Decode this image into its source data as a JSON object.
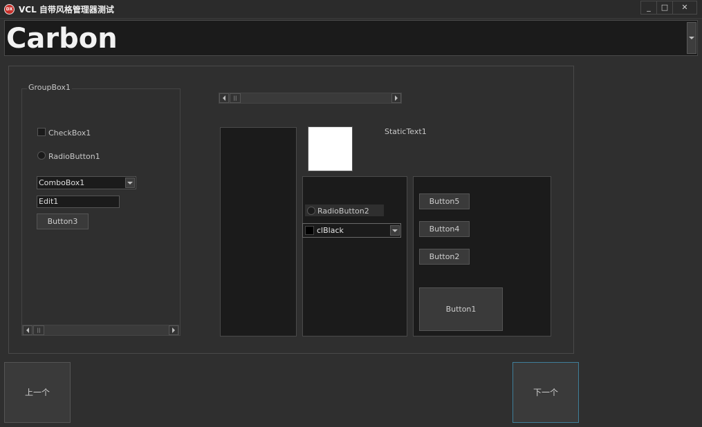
{
  "window": {
    "title": "VCL 自带风格管理器测试",
    "icon_text": "DX",
    "minimize": "_",
    "maximize": "□",
    "close": "✕"
  },
  "style_selector": {
    "value": "Carbon"
  },
  "groupbox": {
    "caption": "GroupBox1",
    "checkbox_label": "CheckBox1",
    "radio_label": "RadioButton1",
    "combobox_value": "ComboBox1",
    "edit_value": "Edit1",
    "button_label": "Button3"
  },
  "controls": {
    "static_text": "StaticText1",
    "radio2_label": "RadioButton2",
    "colorbox_value": "clBlack",
    "button5": "Button5",
    "button4": "Button4",
    "button2": "Button2",
    "button1": "Button1"
  },
  "nav": {
    "prev_label": "上一个",
    "next_label": "下一个"
  },
  "colors": {
    "background": "#2f2f2f",
    "dark_panel": "#1b1b1b",
    "focus_border": "#3f7f9a",
    "app_icon": "#c8302a"
  }
}
